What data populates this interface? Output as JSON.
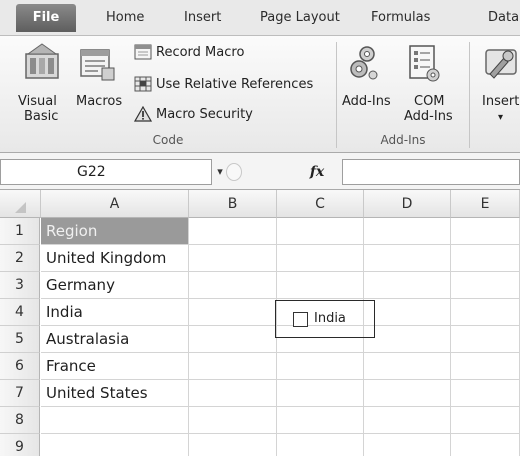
{
  "ribbon_tabs": [
    "File",
    "Home",
    "Insert",
    "Page Layout",
    "Formulas",
    "Data"
  ],
  "ribbon": {
    "code_group": {
      "title": "Code",
      "visual_basic": [
        "Visual",
        "Basic"
      ],
      "macros": "Macros",
      "record_macro": "Record Macro",
      "use_relative_references": "Use Relative References",
      "macro_security": "Macro Security"
    },
    "addins_group": {
      "title": "Add-Ins",
      "add_ins": "Add-Ins",
      "com_add_ins": [
        "COM",
        "Add-Ins"
      ]
    },
    "controls_group": {
      "insert": "Insert",
      "insert_arrow": "▾"
    }
  },
  "formula_bar": {
    "name_box": "G22",
    "dropdown_glyph": "▾",
    "fx": "fx",
    "formula": ""
  },
  "grid": {
    "columns": [
      "A",
      "B",
      "C",
      "D",
      "E"
    ],
    "rows": [
      "1",
      "2",
      "3",
      "4",
      "5",
      "6",
      "7",
      "8",
      "9"
    ],
    "column_a_values": [
      "Region",
      "United Kingdom",
      "Germany",
      "India",
      "Australasia",
      "France",
      "United States",
      "",
      ""
    ]
  },
  "form_control": {
    "type": "checkbox",
    "label": "India",
    "checked": false
  },
  "icons": {
    "visual_basic": "visual-basic-icon",
    "macros": "macros-icon",
    "record_macro": "record-macro-icon",
    "relative_references": "relative-references-icon",
    "macro_security": "warning-icon",
    "add_ins": "gears-icon",
    "com_add_ins": "com-add-ins-icon",
    "insert": "tools-icon"
  },
  "colors": {
    "file_tab": "#6f6f6f",
    "header_cell_fill": "#9a9a9a",
    "header_cell_text": "#f0f0f0"
  }
}
